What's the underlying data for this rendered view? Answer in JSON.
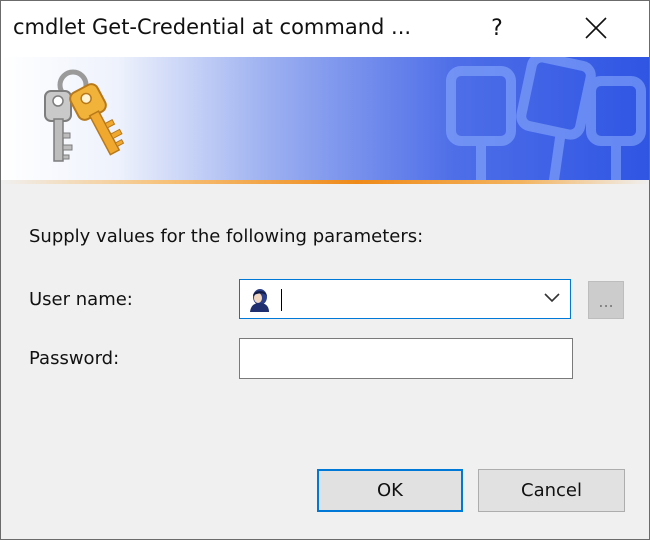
{
  "window": {
    "title": "cmdlet Get-Credential at command ...",
    "help_glyph": "?",
    "close_icon": "close-icon"
  },
  "banner": {
    "icon": "keys-icon",
    "watermark": "keys-watermark-icon",
    "colors": {
      "gradient_end": "#2f55e3",
      "accent_line": "#ee8a1a"
    }
  },
  "form": {
    "prompt": "Supply values for the following parameters:",
    "user_label": "User name:",
    "user_value": "",
    "user_icon": "user-icon",
    "browse_label": "...",
    "password_label": "Password:",
    "password_value": ""
  },
  "buttons": {
    "ok_label": "OK",
    "cancel_label": "Cancel"
  },
  "colors": {
    "focus_border": "#0078d7",
    "dialog_bg": "#f0f0f0"
  }
}
